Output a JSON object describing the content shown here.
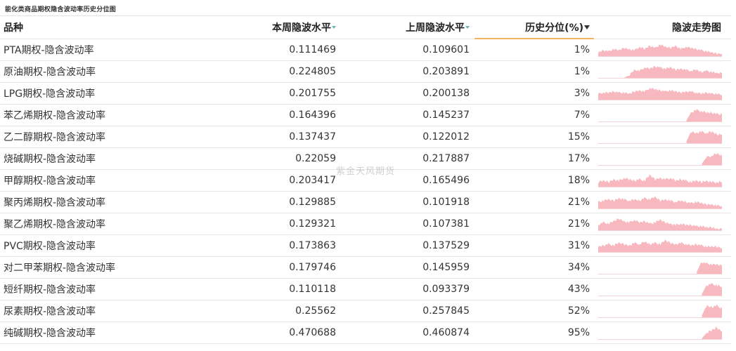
{
  "title": "能化类商品期权隐含波动率历史分位图",
  "watermark": "紫金天风期货",
  "colors": {
    "sparkline": "#f7b8bf",
    "header_underline": "#f3b35a",
    "sort_icon": "#4aa3a0"
  },
  "columns": {
    "name": "品种",
    "current": "本周隐波水平",
    "previous": "上周隐波水平",
    "percentile": "历史分位(%)",
    "trend": "隐波走势图"
  },
  "sort": {
    "column": "percentile",
    "direction": "desc-icon"
  },
  "rows": [
    {
      "name": "PTA期权-隐含波动率",
      "current": "0.111469",
      "previous": "0.109601",
      "percentile": "1%",
      "spark": [
        3,
        5,
        4,
        6,
        5,
        7,
        6,
        5,
        8,
        6,
        9,
        7,
        10,
        8,
        7,
        9,
        6,
        8,
        7,
        6,
        5,
        4,
        3,
        2,
        2
      ]
    },
    {
      "name": "原油期权-隐含波动率",
      "current": "0.224805",
      "previous": "0.203891",
      "percentile": "1%",
      "spark": [
        0,
        0,
        0,
        0,
        0,
        0,
        2,
        7,
        6,
        9,
        8,
        10,
        9,
        8,
        9,
        7,
        8,
        7,
        6,
        7,
        5,
        6,
        5,
        4,
        4
      ]
    },
    {
      "name": "LPG期权-隐含波动率",
      "current": "0.201755",
      "previous": "0.200138",
      "percentile": "3%",
      "spark": [
        5,
        6,
        6,
        7,
        6,
        6,
        5,
        7,
        8,
        7,
        10,
        9,
        8,
        7,
        8,
        7,
        6,
        7,
        7,
        6,
        5,
        6,
        5,
        5,
        4
      ]
    },
    {
      "name": "苯乙烯期权-隐含波动率",
      "current": "0.164396",
      "previous": "0.145237",
      "percentile": "7%",
      "spark": [
        0,
        0,
        0,
        0,
        0,
        0,
        0,
        0,
        0,
        0,
        0,
        0,
        0,
        0,
        0,
        0,
        0,
        0,
        6,
        8,
        7,
        6,
        6,
        5,
        5
      ]
    },
    {
      "name": "乙二醇期权-隐含波动率",
      "current": "0.137437",
      "previous": "0.122012",
      "percentile": "15%",
      "spark": [
        0,
        0,
        0,
        0,
        0,
        0,
        0,
        0,
        0,
        0,
        0,
        0,
        0,
        0,
        0,
        0,
        0,
        0,
        8,
        7,
        8,
        7,
        8,
        6,
        6
      ]
    },
    {
      "name": "烧碱期权-隐含波动率",
      "current": "0.22059",
      "previous": "0.217887",
      "percentile": "17%",
      "spark": [
        0,
        0,
        0,
        0,
        0,
        0,
        0,
        0,
        0,
        0,
        0,
        0,
        0,
        0,
        0,
        0,
        0,
        0,
        0,
        0,
        0,
        6,
        7,
        9,
        7
      ]
    },
    {
      "name": "甲醇期权-隐含波动率",
      "current": "0.203417",
      "previous": "0.165496",
      "percentile": "18%",
      "spark": [
        3,
        4,
        3,
        5,
        4,
        6,
        5,
        4,
        5,
        4,
        8,
        5,
        6,
        5,
        6,
        4,
        5,
        4,
        3,
        4,
        3,
        4,
        3,
        3,
        3
      ]
    },
    {
      "name": "聚丙烯期权-隐含波动率",
      "current": "0.129885",
      "previous": "0.101918",
      "percentile": "21%",
      "spark": [
        5,
        6,
        7,
        6,
        8,
        7,
        6,
        7,
        6,
        8,
        7,
        9,
        6,
        7,
        6,
        5,
        6,
        5,
        4,
        5,
        4,
        3,
        3,
        2,
        2
      ]
    },
    {
      "name": "聚乙烯期权-隐含波动率",
      "current": "0.129321",
      "previous": "0.107381",
      "percentile": "21%",
      "spark": [
        4,
        6,
        5,
        7,
        9,
        7,
        6,
        8,
        6,
        7,
        5,
        6,
        8,
        6,
        5,
        4,
        5,
        4,
        4,
        3,
        3,
        2,
        2,
        1,
        1
      ]
    },
    {
      "name": "PVC期权-隐含波动率",
      "current": "0.173863",
      "previous": "0.137529",
      "percentile": "31%",
      "spark": [
        4,
        5,
        6,
        5,
        7,
        6,
        5,
        7,
        6,
        8,
        6,
        7,
        6,
        9,
        7,
        6,
        7,
        6,
        5,
        6,
        5,
        4,
        4,
        4,
        3
      ]
    },
    {
      "name": "对二甲苯期权-隐含波动率",
      "current": "0.179746",
      "previous": "0.145959",
      "percentile": "34%",
      "spark": [
        0,
        0,
        0,
        0,
        0,
        0,
        0,
        0,
        0,
        0,
        0,
        0,
        0,
        0,
        0,
        0,
        0,
        0,
        0,
        0,
        10,
        9,
        8,
        8,
        7
      ]
    },
    {
      "name": "短纤期权-隐含波动率",
      "current": "0.110118",
      "previous": "0.093379",
      "percentile": "43%",
      "spark": [
        0,
        0,
        0,
        0,
        0,
        0,
        0,
        0,
        0,
        0,
        0,
        0,
        0,
        0,
        0,
        0,
        0,
        0,
        0,
        0,
        0,
        7,
        8,
        7,
        6
      ]
    },
    {
      "name": "尿素期权-隐含波动率",
      "current": "0.25562",
      "previous": "0.257845",
      "percentile": "52%",
      "spark": [
        0,
        0,
        0,
        0,
        0,
        0,
        0,
        0,
        0,
        0,
        0,
        0,
        0,
        0,
        0,
        0,
        0,
        0,
        0,
        0,
        0,
        8,
        7,
        8,
        6
      ]
    },
    {
      "name": "纯碱期权-隐含波动率",
      "current": "0.470688",
      "previous": "0.460874",
      "percentile": "95%",
      "spark": [
        0,
        0,
        0,
        0,
        0,
        0,
        0,
        0,
        0,
        0,
        0,
        0,
        0,
        0,
        0,
        0,
        0,
        0,
        0,
        0,
        0,
        4,
        6,
        8,
        5
      ]
    }
  ]
}
